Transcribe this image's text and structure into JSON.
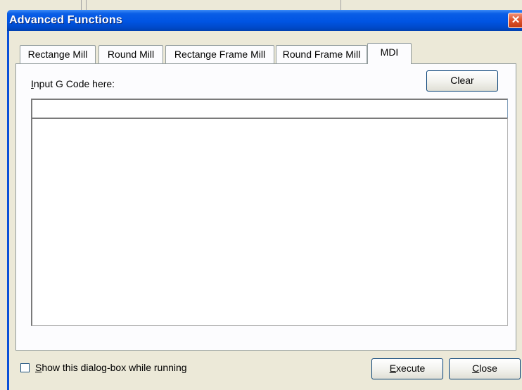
{
  "dialog": {
    "title": "Advanced Functions",
    "close_symbol": "✕"
  },
  "tabs": [
    {
      "label": "Rectange Mill",
      "selected": false
    },
    {
      "label": "Round Mill",
      "selected": false
    },
    {
      "label": "Rectange Frame Mill",
      "selected": false
    },
    {
      "label": "Round Frame Mill",
      "selected": false
    },
    {
      "label": "MDI",
      "selected": true
    }
  ],
  "mdi": {
    "input_label_first": "I",
    "input_label_rest": "nput G Code here:",
    "clear_label": "Clear",
    "gcode_value": "",
    "output_text": ""
  },
  "footer": {
    "show_checkbox_checked": false,
    "show_label_first": "S",
    "show_label_rest": "how this dialog-box while running",
    "execute_first": "E",
    "execute_rest": "xecute",
    "close_first": "C",
    "close_rest": "lose"
  },
  "colors": {
    "titlebar": "#0054e3",
    "face": "#ece9d8",
    "panel": "#fcfcfe",
    "close_button": "#e2562f"
  }
}
